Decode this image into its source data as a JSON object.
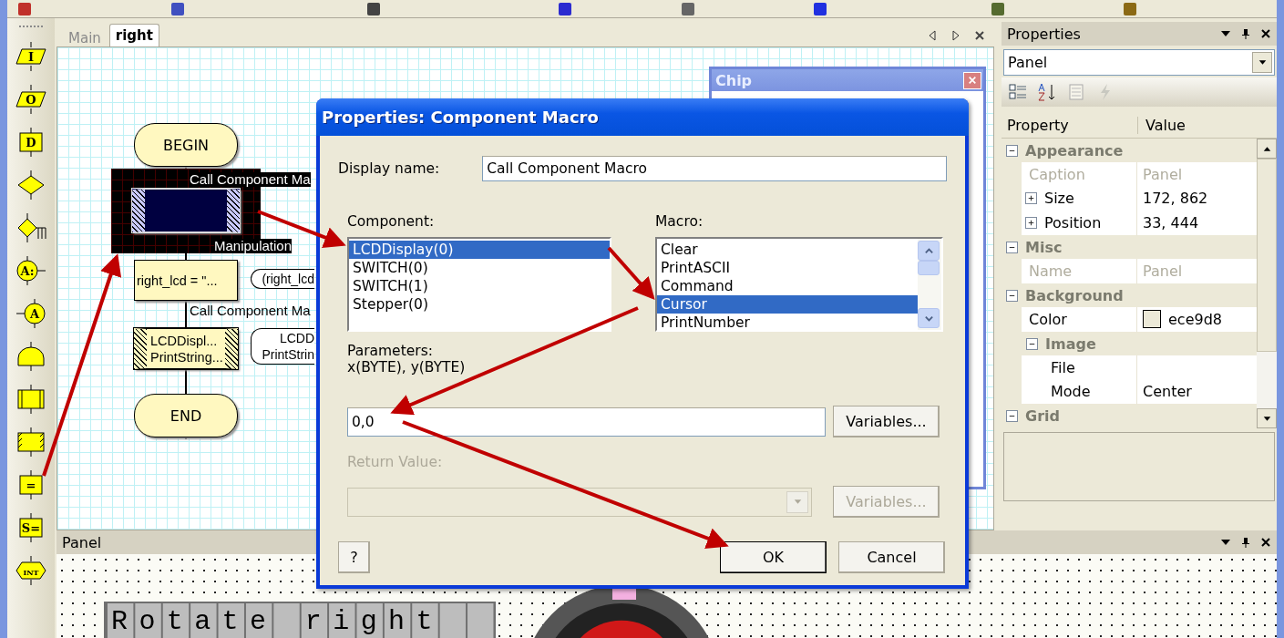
{
  "left_toolbar": [
    {
      "kind": "parallelogram",
      "glyph": "I"
    },
    {
      "kind": "parallelogram",
      "glyph": "O"
    },
    {
      "kind": "square",
      "glyph": "D"
    },
    {
      "kind": "diamond"
    },
    {
      "kind": "switch"
    },
    {
      "kind": "circle-out",
      "glyph": "A:"
    },
    {
      "kind": "circle-in",
      "glyph": "A"
    },
    {
      "kind": "dome"
    },
    {
      "kind": "rect"
    },
    {
      "kind": "hatched"
    },
    {
      "kind": "square",
      "glyph": "="
    },
    {
      "kind": "square",
      "glyph": "S="
    },
    {
      "kind": "hexagon",
      "glyph": "INT"
    }
  ],
  "document_tabs": [
    {
      "label": "Main",
      "selected": false
    },
    {
      "label": "right",
      "selected": true
    }
  ],
  "flowchart": {
    "nodes": [
      {
        "kind": "terminal",
        "text": "BEGIN"
      },
      {
        "kind": "component-macro",
        "selected": true,
        "caption": "Call Component Ma"
      },
      {
        "kind": "calculation",
        "caption": "Manipulation",
        "lines": [
          "right_lcd = \"..."
        ],
        "comment": [
          "(right_lcd"
        ]
      },
      {
        "kind": "component-macro",
        "selected": false,
        "caption": "Call Component Ma",
        "lines": [
          "LCDDispl...",
          "PrintString..."
        ],
        "comment": [
          "LCDD",
          "PrintStrin"
        ]
      },
      {
        "kind": "terminal",
        "text": "END"
      }
    ]
  },
  "chip_window": {
    "title": "Chip"
  },
  "dialog": {
    "title": "Properties: Component Macro",
    "display_name_label": "Display name:",
    "display_name": "Call Component Macro",
    "component_label": "Component:",
    "components": [
      {
        "label": "LCDDisplay(0)",
        "selected": true
      },
      {
        "label": "SWITCH(0)",
        "selected": false
      },
      {
        "label": "SWITCH(1)",
        "selected": false
      },
      {
        "label": "Stepper(0)",
        "selected": false
      }
    ],
    "macro_label": "Macro:",
    "macros": [
      {
        "label": "Clear",
        "selected": false
      },
      {
        "label": "PrintASCII",
        "selected": false
      },
      {
        "label": "Command",
        "selected": false
      },
      {
        "label": "Cursor",
        "selected": true
      },
      {
        "label": "PrintNumber",
        "selected": false
      }
    ],
    "parameters_label": "Parameters:",
    "parameters_signature": "x(BYTE), y(BYTE)",
    "parameters_value": "0,0",
    "variables_button": {
      "label": "Variables...",
      "disabled": false
    },
    "return_label": "Return Value:",
    "return_disabled": true,
    "return_variables_button": {
      "label": "Variables...",
      "disabled": true
    },
    "help_button": "?",
    "ok_button": "OK",
    "cancel_button": "Cancel"
  },
  "properties": {
    "title": "Properties",
    "object": "Panel",
    "header": [
      "Property",
      "Value"
    ],
    "rows": [
      {
        "kind": "category",
        "label": "Appearance",
        "expanded": true,
        "children": [
          {
            "kind": "property",
            "label": "Caption",
            "value": "Panel",
            "disabled": true
          },
          {
            "kind": "property",
            "label": "Size",
            "value": "172, 862",
            "disabled": false,
            "expanded": false
          },
          {
            "kind": "property",
            "label": "Position",
            "value": "33, 444",
            "disabled": false,
            "expanded": false
          }
        ]
      },
      {
        "kind": "category",
        "label": "Misc",
        "expanded": true,
        "children": [
          {
            "kind": "property",
            "label": "Name",
            "value": "Panel",
            "disabled": true
          }
        ]
      },
      {
        "kind": "category",
        "label": "Background",
        "expanded": true,
        "children": [
          {
            "kind": "property",
            "label": "Color",
            "value": "ece9d8",
            "color": "#ece9d8",
            "disabled": false
          },
          {
            "kind": "category",
            "label": "Image",
            "expanded": true,
            "children": [
              {
                "kind": "property",
                "label": "File",
                "disabled": false
              },
              {
                "kind": "property",
                "label": "Mode",
                "value": "Center",
                "disabled": false
              }
            ]
          }
        ]
      },
      {
        "kind": "category",
        "label": "Grid",
        "expanded": true,
        "children": []
      }
    ]
  },
  "panel": {
    "title": "Panel",
    "lcd_text": "Rotate right"
  }
}
